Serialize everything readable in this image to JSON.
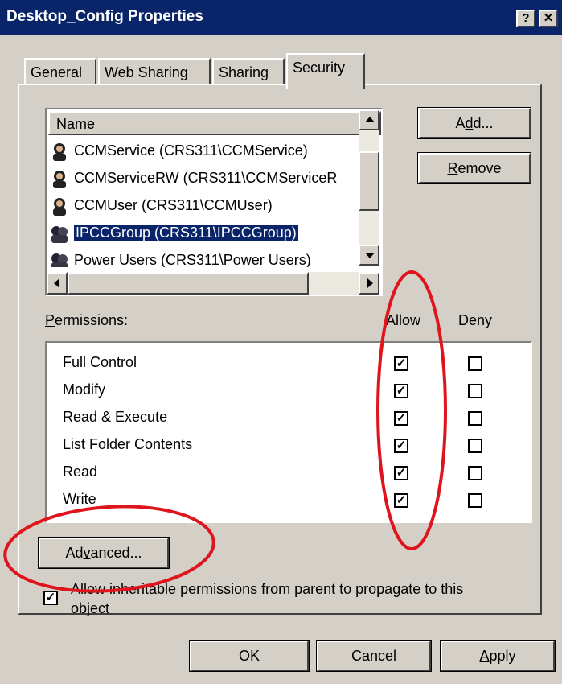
{
  "window": {
    "title": "Desktop_Config Properties",
    "help_button": "?",
    "close_button": "✕"
  },
  "tabs": [
    {
      "label": "General"
    },
    {
      "label": "Web Sharing"
    },
    {
      "label": "Sharing"
    },
    {
      "label": "Security",
      "active": true
    }
  ],
  "users_list": {
    "header": "Name",
    "rows": [
      {
        "label": "CCMService (CRS311\\CCMService)",
        "icon": "user-icon"
      },
      {
        "label": "CCMServiceRW (CRS311\\CCMServiceR",
        "icon": "user-icon"
      },
      {
        "label": "CCMUser (CRS311\\CCMUser)",
        "icon": "user-icon"
      },
      {
        "label": "IPCCGroup (CRS311\\IPCCGroup)",
        "icon": "group-icon",
        "selected": true
      },
      {
        "label": "Power Users (CRS311\\Power Users)",
        "icon": "group-icon"
      }
    ]
  },
  "buttons": {
    "add": {
      "pre": "A",
      "ul": "d",
      "post": "d..."
    },
    "remove": {
      "pre": "",
      "ul": "R",
      "post": "emove"
    },
    "advanced": {
      "pre": "Ad",
      "ul": "v",
      "post": "anced..."
    },
    "ok": "OK",
    "cancel": "Cancel",
    "apply": {
      "pre": "",
      "ul": "A",
      "post": "pply"
    }
  },
  "permissions": {
    "label": {
      "pre": "",
      "ul": "P",
      "post": "ermissions:"
    },
    "allow_header": "Allow",
    "deny_header": "Deny",
    "rows": [
      {
        "name": "Full Control",
        "allow": true,
        "deny": false
      },
      {
        "name": "Modify",
        "allow": true,
        "deny": false
      },
      {
        "name": "Read & Execute",
        "allow": true,
        "deny": false
      },
      {
        "name": "List Folder Contents",
        "allow": true,
        "deny": false
      },
      {
        "name": "Read",
        "allow": true,
        "deny": false
      },
      {
        "name": "Write",
        "allow": true,
        "deny": false
      }
    ]
  },
  "inherit": {
    "checked": true,
    "line1": "Allow inheritable permissions from parent to propagate to this",
    "line2": "object"
  },
  "annotation_color": "#e0141c"
}
